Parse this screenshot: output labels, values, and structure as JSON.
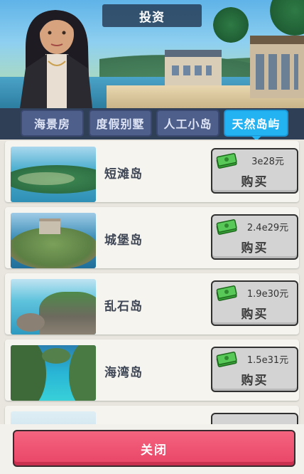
{
  "header": {
    "title": "投资"
  },
  "tabs": [
    {
      "label": "海景房",
      "active": false
    },
    {
      "label": "度假别墅",
      "active": false
    },
    {
      "label": "人工小岛",
      "active": false
    },
    {
      "label": "天然岛屿",
      "active": true
    }
  ],
  "items": [
    {
      "name": "短滩岛",
      "price": "3e28元",
      "buy_label": "购买",
      "thumb": "flat-island-thumbnail"
    },
    {
      "name": "城堡岛",
      "price": "2.4e29元",
      "buy_label": "购买",
      "thumb": "castle-island-thumbnail"
    },
    {
      "name": "乱石岛",
      "price": "1.9e30元",
      "buy_label": "购买",
      "thumb": "rocky-island-thumbnail"
    },
    {
      "name": "海湾岛",
      "price": "1.5e31元",
      "buy_label": "购买",
      "thumb": "bay-island-thumbnail"
    }
  ],
  "footer": {
    "close_label": "关闭"
  },
  "colors": {
    "active_tab": "#23b2f2",
    "inactive_tab": "#4e5f8c",
    "close_button": "#ee5574",
    "buy_button": "#d3d3d3",
    "cash_icon": "#4cc04a"
  }
}
